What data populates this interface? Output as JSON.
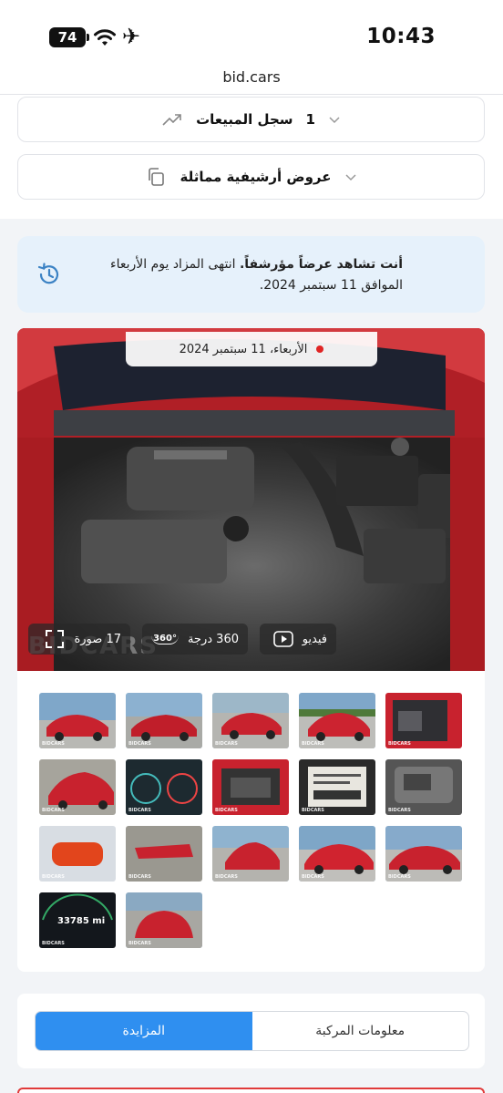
{
  "status_bar": {
    "battery": "74",
    "time": "10:43",
    "icons": [
      "wifi-icon",
      "airplane-icon"
    ]
  },
  "browser": {
    "url": "bid.cars"
  },
  "sales_history": {
    "count": "1",
    "title": "سجل المبيعات",
    "icon": "trending-up-icon"
  },
  "similar_archive": {
    "title": "عروض أرشيفية مماثلة",
    "icon": "copy-icon"
  },
  "notice": {
    "bold_text": "أنت تشاهد عرضاً مؤرشفاً.",
    "text": "انتهى المزاد يوم الأربعاء الموافق 11 سبتمبر 2024.",
    "icon": "history-icon"
  },
  "gallery": {
    "date": "الأربعاء، 11 سبتمبر 2024",
    "photos_label": "17 صورة",
    "view360_label": "360 درجة",
    "view360_badge": "360°",
    "video_label": "فيديو",
    "watermark": "BIDCARS",
    "thumb_watermark": "BIDCARS",
    "odometer": "33785 mi"
  },
  "tabs": {
    "auction": "المزايدة",
    "vehicle_info": "معلومات المركبة",
    "active": "auction"
  },
  "colors": {
    "accent": "#2f8ff0",
    "notice_bg": "#e6f1fb",
    "live_dot": "#e02424",
    "car_red": "#c8222e"
  }
}
